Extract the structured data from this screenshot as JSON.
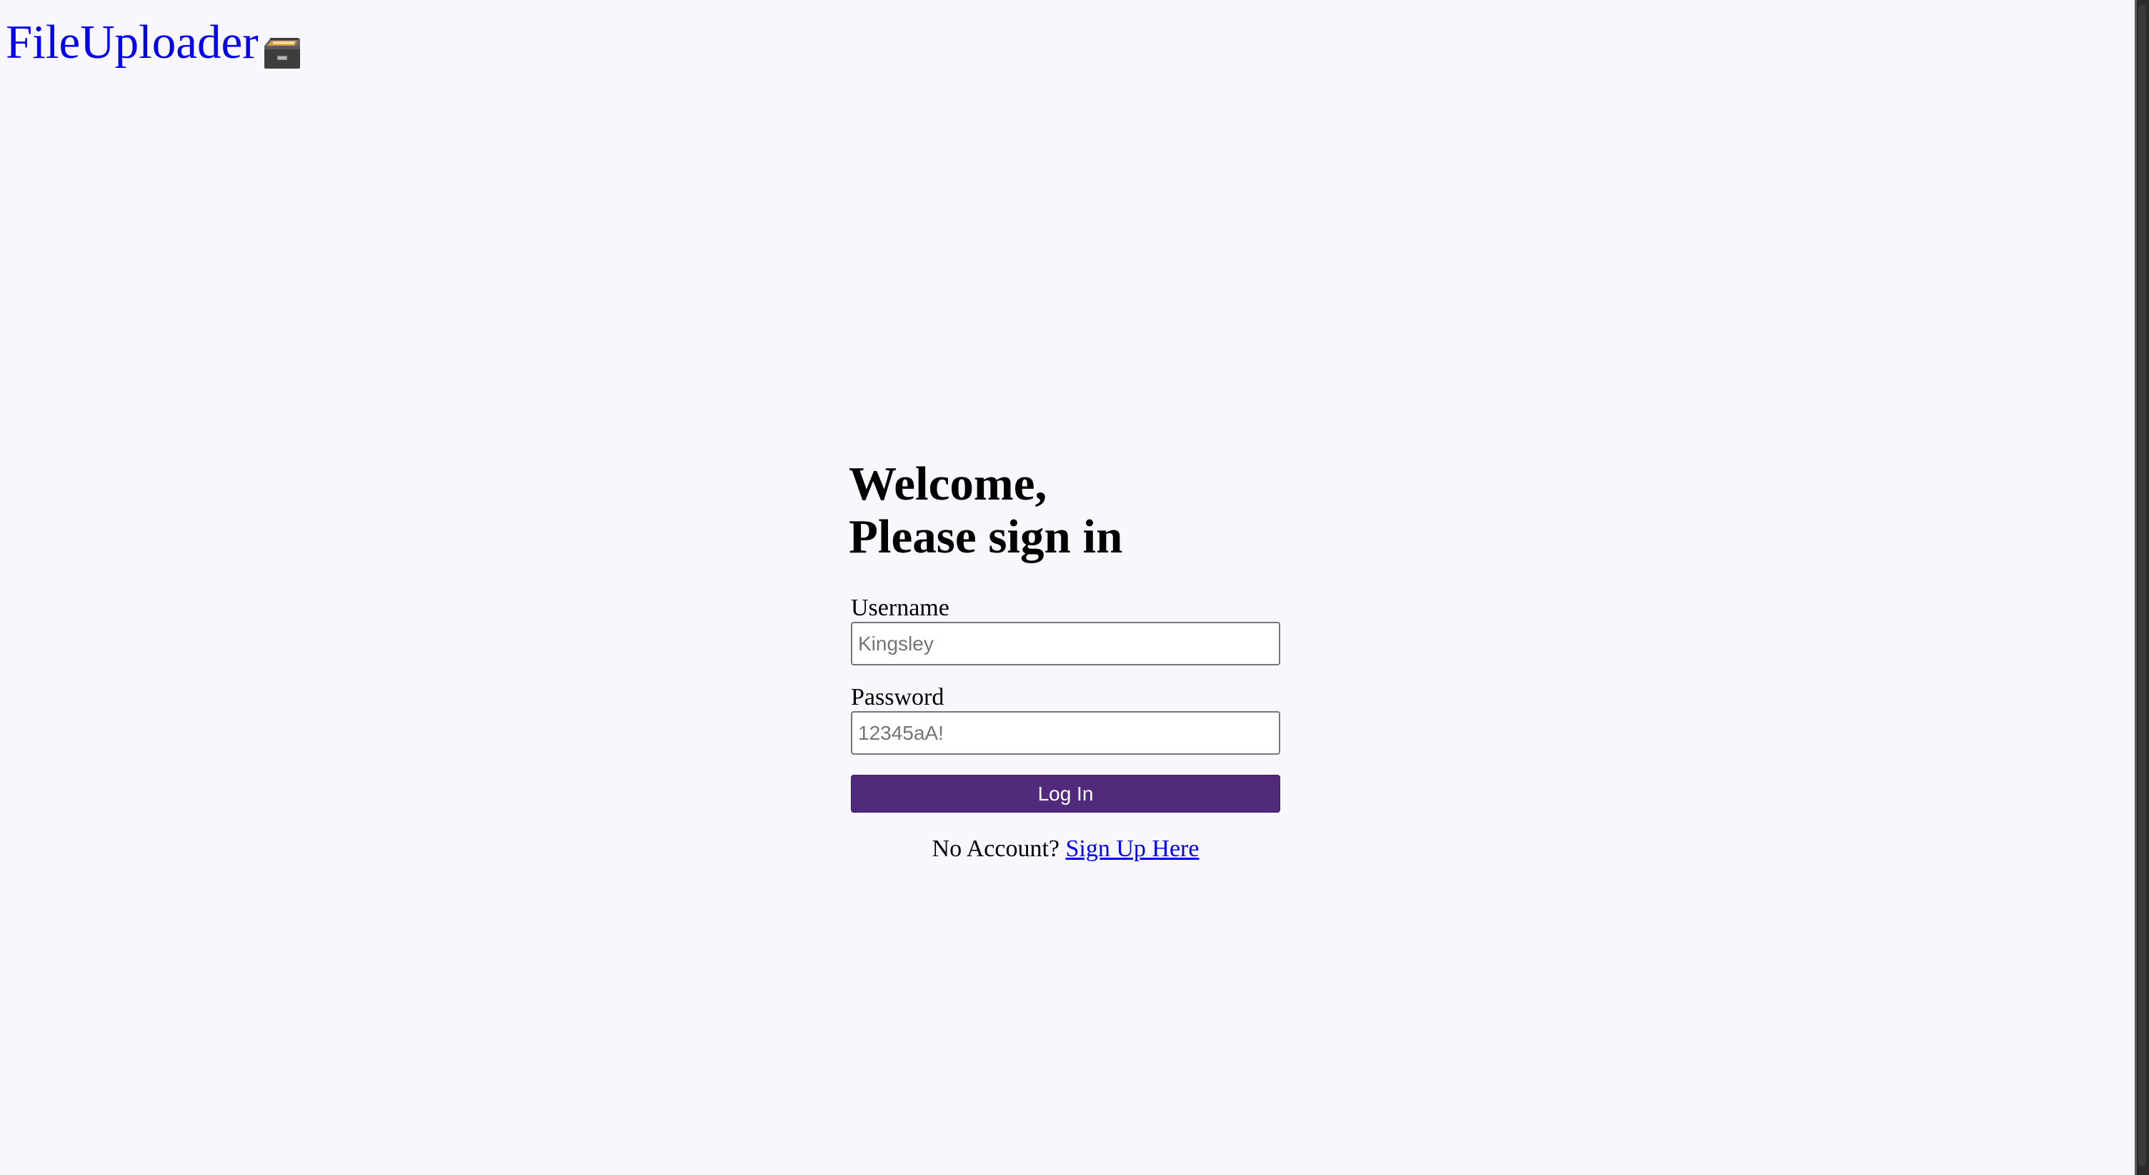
{
  "header": {
    "logo_text": "FileUploader",
    "logo_icon": "file-cabinet-icon"
  },
  "login": {
    "title_line1": "Welcome,",
    "title_line2": "Please sign in",
    "username_label": "Username",
    "username_placeholder": "Kingsley",
    "password_label": "Password",
    "password_placeholder": "12345aA!",
    "submit_label": "Log In",
    "signup_prompt": "No Account?",
    "signup_link": "Sign Up Here"
  },
  "colors": {
    "background": "#f8f7fd",
    "link": "#0000ee",
    "button": "#512a7b",
    "button_text": "#ffffff"
  }
}
